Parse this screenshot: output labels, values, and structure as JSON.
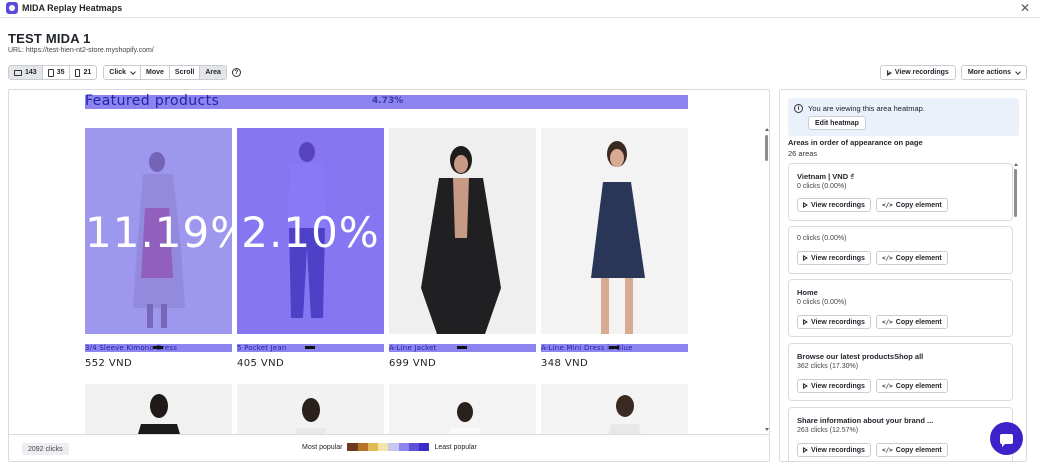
{
  "window": {
    "title": "MIDA Replay Heatmaps"
  },
  "page": {
    "title": "TEST MIDA 1",
    "url": "URL: https://test-hien-nt2-store.myshopify.com/"
  },
  "toolbar": {
    "devices": [
      {
        "icon": "desktop-icon",
        "count": "143",
        "active": true
      },
      {
        "icon": "tablet-icon",
        "count": "35",
        "active": false
      },
      {
        "icon": "mobile-icon",
        "count": "21",
        "active": false
      }
    ],
    "modes": [
      {
        "label": "Click",
        "dropdown": true,
        "active": false
      },
      {
        "label": "Move",
        "active": false
      },
      {
        "label": "Scroll",
        "active": false
      },
      {
        "label": "Area",
        "active": true
      }
    ],
    "help_icon": "help-icon"
  },
  "actions": {
    "view_recordings": "View recordings",
    "more_actions": "More actions"
  },
  "heatmap": {
    "section_title": "Featured products",
    "section_pct": "4.73%",
    "products": [
      {
        "name": "3/4 Sleeve Kimono Dress",
        "price": "552 VND",
        "pct": "11.19%"
      },
      {
        "name": "5 Pocket Jean",
        "price": "405 VND",
        "pct": "2.10%"
      },
      {
        "name": "A-Line Jacket",
        "price": "699 VND",
        "pct": ""
      },
      {
        "name": "A-Line Mini Dress in Blue",
        "price": "348 VND",
        "pct": ""
      }
    ],
    "total_clicks": "2092 clicks",
    "legend": {
      "most": "Most popular",
      "least": "Least popular",
      "colors": [
        "#6b3a1e",
        "#b7722b",
        "#e2b857",
        "#f1e5a8",
        "#c9c5f1",
        "#8f84ec",
        "#5d50db",
        "#3b2cc9"
      ]
    }
  },
  "panel": {
    "info_text": "You are viewing this area heatmap.",
    "edit_button": "Edit heatmap",
    "areas_heading": "Areas in order of appearance on page",
    "areas_count": "26 areas",
    "cards": [
      {
        "title": "Vietnam | VND ₫",
        "clicks": "0 clicks (0.00%)"
      },
      {
        "title": "",
        "clicks": "0 clicks (0.00%)"
      },
      {
        "title": "Home",
        "clicks": "0 clicks (0.00%)"
      },
      {
        "title": "Browse our latest productsShop all",
        "clicks": "362 clicks (17.30%)"
      },
      {
        "title": "Share information about your brand ...",
        "clicks": "263 clicks (12.57%)"
      }
    ],
    "view_recordings": "View recordings",
    "copy_element": "Copy element"
  }
}
